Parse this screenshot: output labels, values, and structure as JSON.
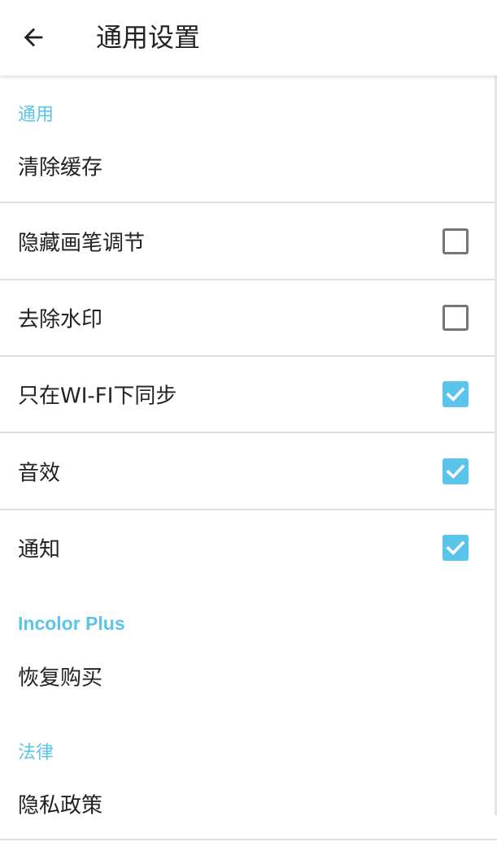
{
  "header": {
    "title": "通用设置",
    "back_icon": "arrow-back-icon"
  },
  "accent_color": "#5bc4ea",
  "sections": [
    {
      "header": "通用",
      "items": [
        {
          "label": "清除缓存"
        },
        {
          "label": "隐藏画笔调节",
          "checked": false
        },
        {
          "label": "去除水印",
          "checked": false
        },
        {
          "label": "只在WI-FI下同步",
          "checked": true
        },
        {
          "label": "音效",
          "checked": true
        },
        {
          "label": "通知",
          "checked": true
        }
      ]
    },
    {
      "header": "Incolor Plus",
      "items": [
        {
          "label": "恢复购买"
        }
      ]
    },
    {
      "header": "法律",
      "items": [
        {
          "label": "隐私政策"
        }
      ]
    }
  ]
}
